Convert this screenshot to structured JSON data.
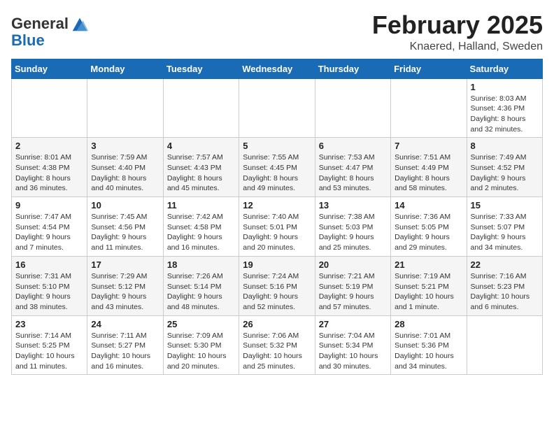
{
  "header": {
    "logo_line1": "General",
    "logo_line2": "Blue",
    "month_title": "February 2025",
    "location": "Knaered, Halland, Sweden"
  },
  "days_of_week": [
    "Sunday",
    "Monday",
    "Tuesday",
    "Wednesday",
    "Thursday",
    "Friday",
    "Saturday"
  ],
  "weeks": [
    [
      {
        "day": "",
        "info": ""
      },
      {
        "day": "",
        "info": ""
      },
      {
        "day": "",
        "info": ""
      },
      {
        "day": "",
        "info": ""
      },
      {
        "day": "",
        "info": ""
      },
      {
        "day": "",
        "info": ""
      },
      {
        "day": "1",
        "info": "Sunrise: 8:03 AM\nSunset: 4:36 PM\nDaylight: 8 hours and 32 minutes."
      }
    ],
    [
      {
        "day": "2",
        "info": "Sunrise: 8:01 AM\nSunset: 4:38 PM\nDaylight: 8 hours and 36 minutes."
      },
      {
        "day": "3",
        "info": "Sunrise: 7:59 AM\nSunset: 4:40 PM\nDaylight: 8 hours and 40 minutes."
      },
      {
        "day": "4",
        "info": "Sunrise: 7:57 AM\nSunset: 4:43 PM\nDaylight: 8 hours and 45 minutes."
      },
      {
        "day": "5",
        "info": "Sunrise: 7:55 AM\nSunset: 4:45 PM\nDaylight: 8 hours and 49 minutes."
      },
      {
        "day": "6",
        "info": "Sunrise: 7:53 AM\nSunset: 4:47 PM\nDaylight: 8 hours and 53 minutes."
      },
      {
        "day": "7",
        "info": "Sunrise: 7:51 AM\nSunset: 4:49 PM\nDaylight: 8 hours and 58 minutes."
      },
      {
        "day": "8",
        "info": "Sunrise: 7:49 AM\nSunset: 4:52 PM\nDaylight: 9 hours and 2 minutes."
      }
    ],
    [
      {
        "day": "9",
        "info": "Sunrise: 7:47 AM\nSunset: 4:54 PM\nDaylight: 9 hours and 7 minutes."
      },
      {
        "day": "10",
        "info": "Sunrise: 7:45 AM\nSunset: 4:56 PM\nDaylight: 9 hours and 11 minutes."
      },
      {
        "day": "11",
        "info": "Sunrise: 7:42 AM\nSunset: 4:58 PM\nDaylight: 9 hours and 16 minutes."
      },
      {
        "day": "12",
        "info": "Sunrise: 7:40 AM\nSunset: 5:01 PM\nDaylight: 9 hours and 20 minutes."
      },
      {
        "day": "13",
        "info": "Sunrise: 7:38 AM\nSunset: 5:03 PM\nDaylight: 9 hours and 25 minutes."
      },
      {
        "day": "14",
        "info": "Sunrise: 7:36 AM\nSunset: 5:05 PM\nDaylight: 9 hours and 29 minutes."
      },
      {
        "day": "15",
        "info": "Sunrise: 7:33 AM\nSunset: 5:07 PM\nDaylight: 9 hours and 34 minutes."
      }
    ],
    [
      {
        "day": "16",
        "info": "Sunrise: 7:31 AM\nSunset: 5:10 PM\nDaylight: 9 hours and 38 minutes."
      },
      {
        "day": "17",
        "info": "Sunrise: 7:29 AM\nSunset: 5:12 PM\nDaylight: 9 hours and 43 minutes."
      },
      {
        "day": "18",
        "info": "Sunrise: 7:26 AM\nSunset: 5:14 PM\nDaylight: 9 hours and 48 minutes."
      },
      {
        "day": "19",
        "info": "Sunrise: 7:24 AM\nSunset: 5:16 PM\nDaylight: 9 hours and 52 minutes."
      },
      {
        "day": "20",
        "info": "Sunrise: 7:21 AM\nSunset: 5:19 PM\nDaylight: 9 hours and 57 minutes."
      },
      {
        "day": "21",
        "info": "Sunrise: 7:19 AM\nSunset: 5:21 PM\nDaylight: 10 hours and 1 minute."
      },
      {
        "day": "22",
        "info": "Sunrise: 7:16 AM\nSunset: 5:23 PM\nDaylight: 10 hours and 6 minutes."
      }
    ],
    [
      {
        "day": "23",
        "info": "Sunrise: 7:14 AM\nSunset: 5:25 PM\nDaylight: 10 hours and 11 minutes."
      },
      {
        "day": "24",
        "info": "Sunrise: 7:11 AM\nSunset: 5:27 PM\nDaylight: 10 hours and 16 minutes."
      },
      {
        "day": "25",
        "info": "Sunrise: 7:09 AM\nSunset: 5:30 PM\nDaylight: 10 hours and 20 minutes."
      },
      {
        "day": "26",
        "info": "Sunrise: 7:06 AM\nSunset: 5:32 PM\nDaylight: 10 hours and 25 minutes."
      },
      {
        "day": "27",
        "info": "Sunrise: 7:04 AM\nSunset: 5:34 PM\nDaylight: 10 hours and 30 minutes."
      },
      {
        "day": "28",
        "info": "Sunrise: 7:01 AM\nSunset: 5:36 PM\nDaylight: 10 hours and 34 minutes."
      },
      {
        "day": "",
        "info": ""
      }
    ]
  ]
}
